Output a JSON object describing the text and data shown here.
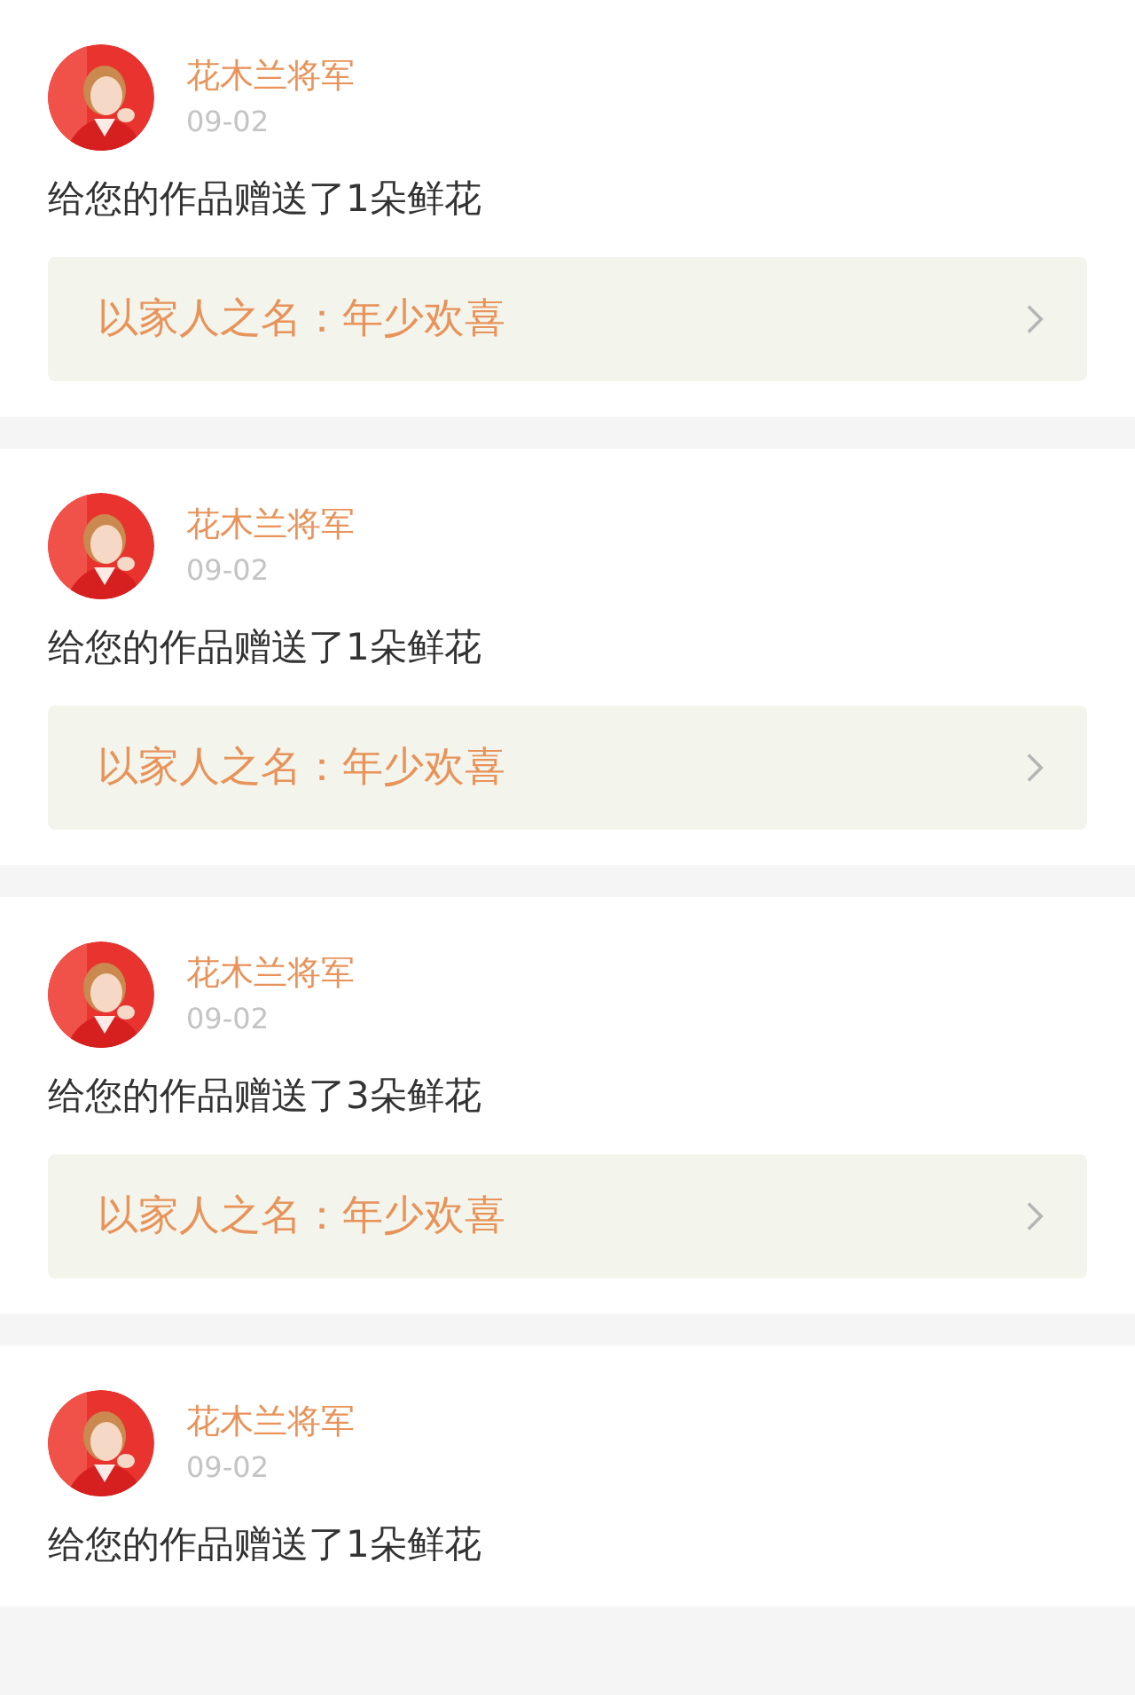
{
  "items": [
    {
      "name": "花木兰将军",
      "date": "09-02",
      "message": "给您的作品赠送了1朵鲜花",
      "link": "以家人之名：年少欢喜"
    },
    {
      "name": "花木兰将军",
      "date": "09-02",
      "message": "给您的作品赠送了1朵鲜花",
      "link": "以家人之名：年少欢喜"
    },
    {
      "name": "花木兰将军",
      "date": "09-02",
      "message": "给您的作品赠送了3朵鲜花",
      "link": "以家人之名：年少欢喜"
    },
    {
      "name": "花木兰将军",
      "date": "09-02",
      "message": "给您的作品赠送了1朵鲜花"
    }
  ]
}
